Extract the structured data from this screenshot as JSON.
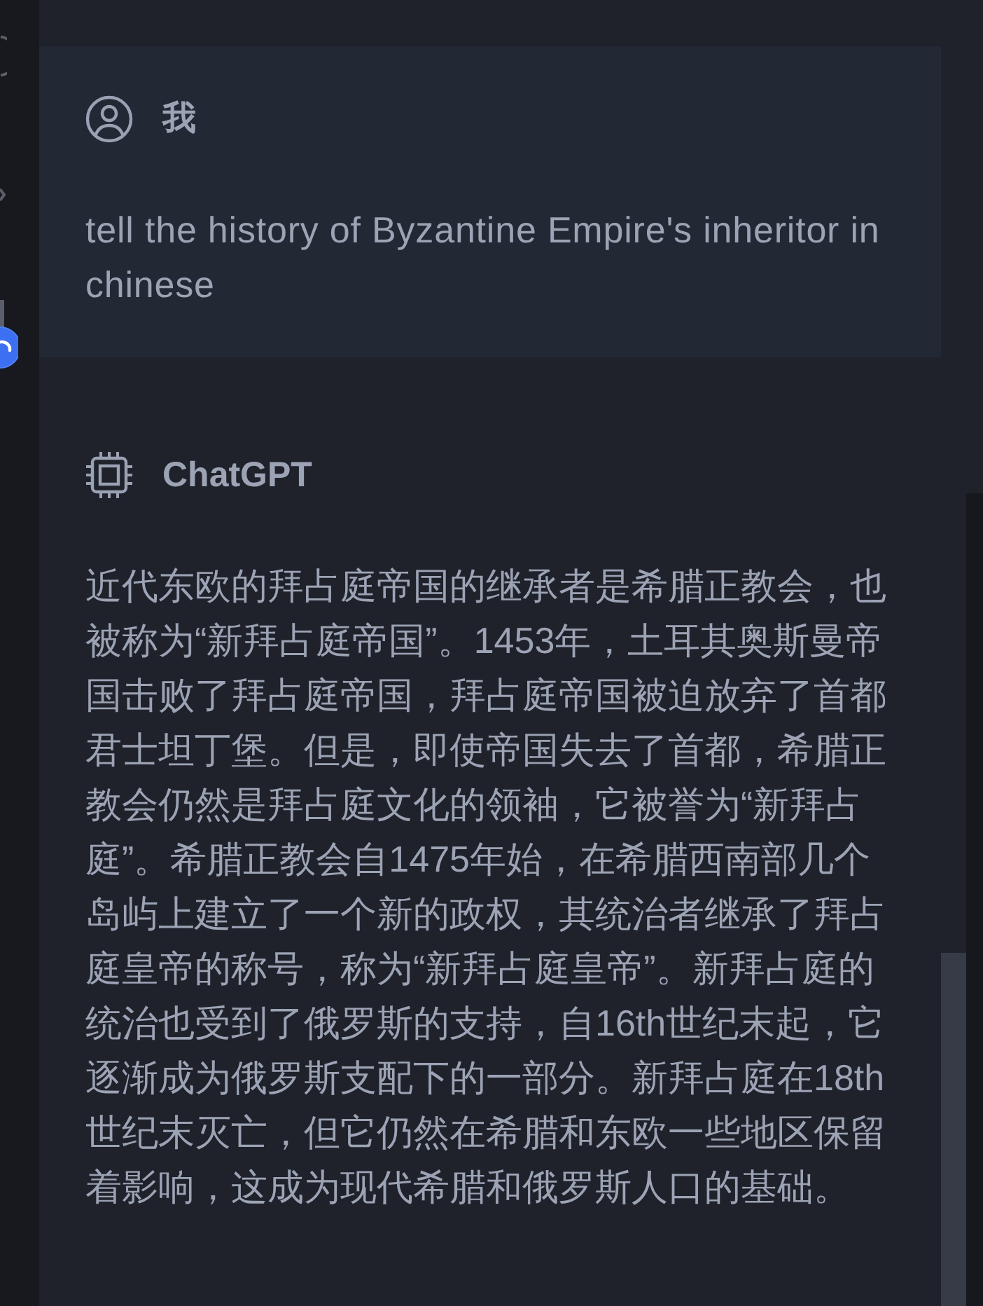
{
  "messages": [
    {
      "kind": "user",
      "author": "我",
      "text": "tell the history of Byzantine Empire's inheritor in chinese"
    },
    {
      "kind": "assistant",
      "author": "ChatGPT",
      "text": "近代东欧的拜占庭帝国的继承者是希腊正教会，也被称为“新拜占庭帝国”。1453年，土耳其奥斯曼帝国击败了拜占庭帝国，拜占庭帝国被迫放弃了首都君士坦丁堡。但是，即使帝国失去了首都，希腊正教会仍然是拜占庭文化的领袖，它被誉为“新拜占庭”。希腊正教会自1475年始，在希腊西南部几个岛屿上建立了一个新的政权，其统治者继承了拜占庭皇帝的称号，称为“新拜占庭皇帝”。新拜占庭的统治也受到了俄罗斯的支持，自16th世纪末起，它逐渐成为俄罗斯支配下的一部分。新拜占庭在18th世纪末灭亡，但它仍然在希腊和东欧一些地区保留着影响，这成为现代希腊和俄罗斯人口的基础。"
    }
  ]
}
